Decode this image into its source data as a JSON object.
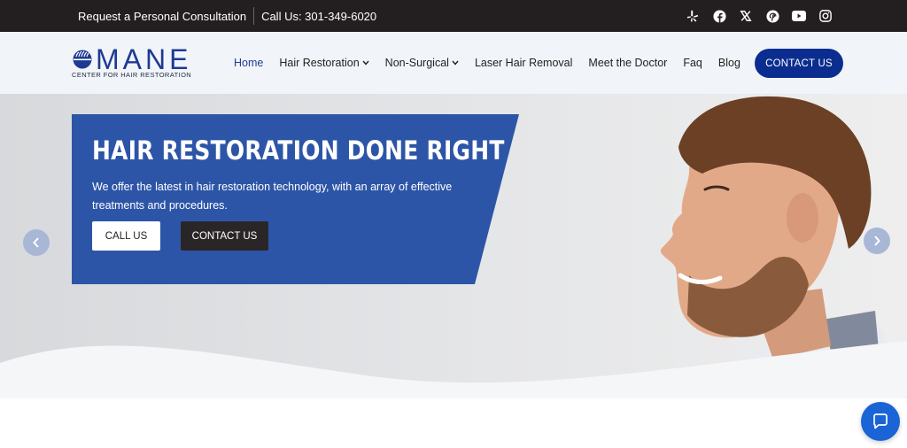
{
  "topbar": {
    "consultation": "Request a Personal Consultation",
    "phone": "Call Us: 301-349-6020",
    "social": [
      "yelp-icon",
      "facebook-icon",
      "x-icon",
      "pinterest-icon",
      "youtube-icon",
      "instagram-icon"
    ]
  },
  "logo": {
    "name": "MANE",
    "subtitle": "CENTER FOR HAIR RESTORATION"
  },
  "nav": {
    "items": [
      {
        "label": "Home",
        "active": true,
        "dropdown": false
      },
      {
        "label": "Hair Restoration",
        "active": false,
        "dropdown": true
      },
      {
        "label": "Non-Surgical",
        "active": false,
        "dropdown": true
      },
      {
        "label": "Laser Hair Removal",
        "active": false,
        "dropdown": false
      },
      {
        "label": "Meet the Doctor",
        "active": false,
        "dropdown": false
      },
      {
        "label": "Faq",
        "active": false,
        "dropdown": false
      },
      {
        "label": "Blog",
        "active": false,
        "dropdown": false
      }
    ],
    "contact_label": "CONTACT US"
  },
  "hero": {
    "title": "HAIR RESTORATION DONE RIGHT",
    "description": "We offer the latest in hair restoration technology, with an array of effective treatments and procedures.",
    "call_label": "CALL US",
    "contact_label": "CONTACT US"
  },
  "colors": {
    "topbar": "#231f20",
    "accent": "#0a2d8f",
    "card": "#2d55a7",
    "chat": "#1a64d6"
  }
}
